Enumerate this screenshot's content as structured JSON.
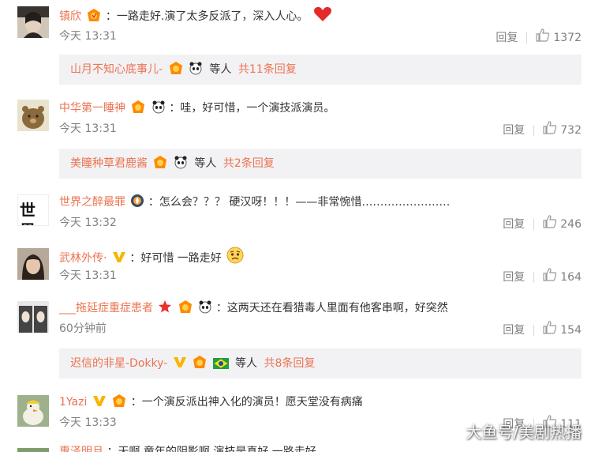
{
  "colors": {
    "username": "#eb7350",
    "text": "#333333",
    "meta": "#808080",
    "reply_bg": "#f2f2f5"
  },
  "comments": [
    {
      "username": "镇欣",
      "text": "：一路走好.演了太多反派了，深入人心。",
      "time": "今天 13:31",
      "reply_label": "回复",
      "likes": "1372",
      "badges": [
        "member-badge"
      ],
      "trailing": "red-heart-icon",
      "sub": {
        "names": "山月不知心底事儿-",
        "mid": "等人",
        "count": "共11条回复"
      }
    },
    {
      "username": "中华第一睡神",
      "text": "：哇，好可惜，一个演技派演员。",
      "time": "今天 13:31",
      "reply_label": "回复",
      "likes": "732",
      "badges": [
        "member-badge",
        "panda-badge"
      ],
      "sub": {
        "names": "美瞳种草君鹿酱",
        "mid": "等人",
        "count": "共2条回复"
      }
    },
    {
      "username": "世界之醉最罪",
      "text": "：怎么会？？？ 硬汉呀！！！——非常惋惜……………………",
      "time": "今天 13:32",
      "reply_label": "回复",
      "likes": "246",
      "badges": [
        "compass-badge"
      ],
      "avatar_text": "世界"
    },
    {
      "username": "武林外传·",
      "text": "：好可惜 一路走好",
      "time": "今天 13:31",
      "reply_label": "回复",
      "likes": "164",
      "badges": [
        "verified-v-badge"
      ],
      "trailing": "sad-face-icon"
    },
    {
      "username": "___拖延症重症患者",
      "text": "：这两天还在看猎毒人里面有他客串啊，好突然",
      "time": "60分钟前",
      "reply_label": "回复",
      "likes": "154",
      "badges": [
        "star-badge",
        "member-badge",
        "panda-badge"
      ],
      "sub": {
        "names": "迟信的非星-Dokky-",
        "mid": "等人",
        "count": "共8条回复"
      }
    },
    {
      "username": "1Yazi",
      "text": "：一个演反派出神入化的演员！愿天堂没有病痛",
      "time": "今天 13:33",
      "reply_label": "回复",
      "likes": "111",
      "badges": [
        "verified-v-badge",
        "member-badge"
      ]
    },
    {
      "username": "惠泽明月",
      "text": "：天啊 童年的阴影啊 演技是真好 一路走好"
    }
  ],
  "watermark": "大鱼号/美剧热播"
}
